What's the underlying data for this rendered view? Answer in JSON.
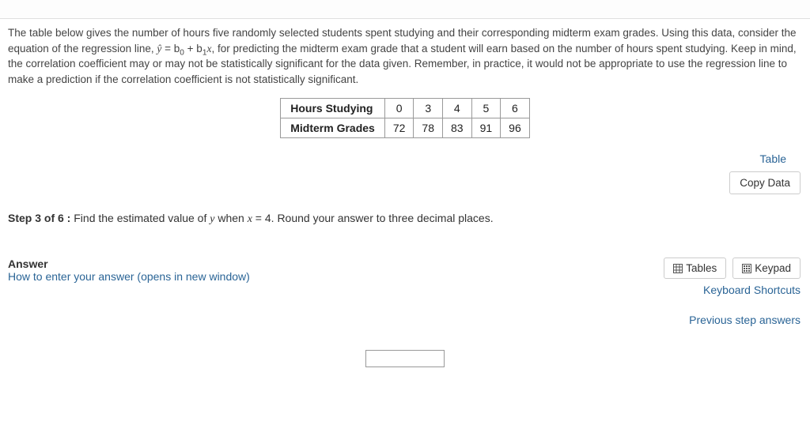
{
  "problem": {
    "intro_prefix": "The table below gives the number of hours five randomly selected students spent studying and their corresponding midterm exam grades. Using this data, consider the equation of the regression line, ",
    "eq_left": "ŷ",
    "eq_mid": " = b",
    "eq_sub0": "0",
    "eq_plus": " + b",
    "eq_sub1": "1",
    "eq_x": "x",
    "intro_suffix": ", for predicting the midterm exam grade that a student will earn based on the number of hours spent studying. Keep in mind, the correlation coefficient may or may not be statistically significant for the data given. Remember, in practice, it would not be appropriate to use the regression line to make a prediction if the correlation coefficient is not statistically significant."
  },
  "table": {
    "row1_header": "Hours Studying",
    "row1": [
      "0",
      "3",
      "4",
      "5",
      "6"
    ],
    "row2_header": "Midterm Grades",
    "row2": [
      "72",
      "78",
      "83",
      "91",
      "96"
    ]
  },
  "links": {
    "table": "Table",
    "copy": "Copy Data",
    "tables_btn": "Tables",
    "keypad_btn": "Keypad",
    "kb_shortcuts": "Keyboard Shortcuts",
    "prev_answers": "Previous step answers",
    "how_enter": "How to enter your answer (opens in new window)"
  },
  "step": {
    "label": "Step 3 of 6 :",
    "text_before": "  Find the estimated value of ",
    "y_var": "y",
    "text_mid": " when ",
    "x_var": "x",
    "eq": " = 4",
    "text_after": ". Round your answer to three decimal places."
  },
  "answer": {
    "label": "Answer",
    "value": ""
  },
  "chart_data": {
    "type": "table",
    "title": "Hours Studying vs Midterm Grades",
    "columns": [
      "Hours Studying",
      "Midterm Grades"
    ],
    "rows": [
      [
        0,
        72
      ],
      [
        3,
        78
      ],
      [
        4,
        83
      ],
      [
        5,
        91
      ],
      [
        6,
        96
      ]
    ]
  }
}
